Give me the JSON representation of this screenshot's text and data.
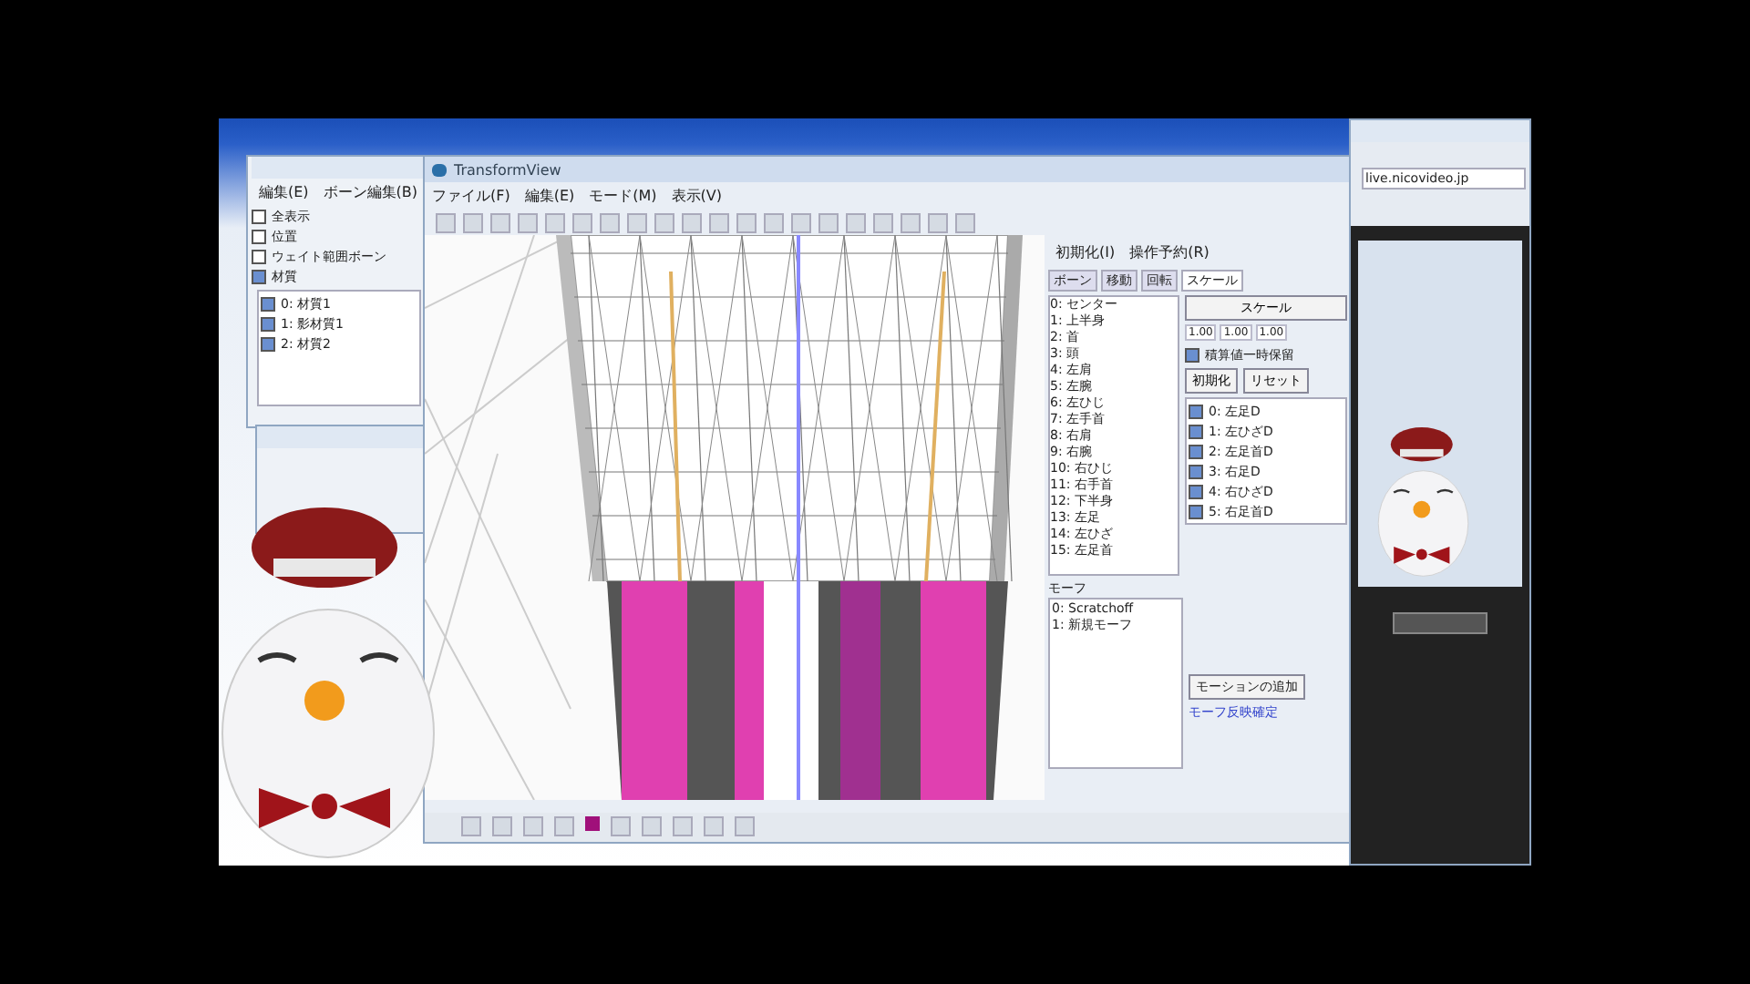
{
  "left_panel": {
    "menu": [
      "編集(E)",
      "ボーン編集(B)"
    ],
    "options": [
      {
        "label": "全表示",
        "checked": false
      },
      {
        "label": "位置",
        "checked": false
      },
      {
        "label": "ウェイト範囲ボーン",
        "checked": false
      },
      {
        "label": "材質",
        "checked": true
      }
    ],
    "items": [
      {
        "label": "0: 材質1",
        "checked": true
      },
      {
        "label": "1: 影材質1",
        "checked": true
      },
      {
        "label": "2: 材質2",
        "checked": true
      }
    ]
  },
  "main_window": {
    "title": "TransformView",
    "menu": [
      "ファイル(F)",
      "編集(E)",
      "モード(M)",
      "表示(V)"
    ]
  },
  "side_panel": {
    "menu": [
      "初期化(I)",
      "操作予約(R)"
    ],
    "tabs": [
      {
        "label": "ボーン",
        "selected": false
      },
      {
        "label": "移動",
        "selected": false
      },
      {
        "label": "回転",
        "selected": false
      },
      {
        "label": "スケール",
        "selected": true
      }
    ],
    "bones": [
      "0: センター",
      "1: 上半身",
      "2: 首",
      "3: 頭",
      "4: 左肩",
      "5: 左腕",
      "6: 左ひじ",
      "7: 左手首",
      "8: 右肩",
      "9: 右腕",
      "10: 右ひじ",
      "11: 右手首",
      "12: 下半身",
      "13: 左足",
      "14: 左ひざ",
      "15: 左足首"
    ],
    "scale_button": "スケール",
    "values": [
      "1.00",
      "1.00",
      "1.00"
    ],
    "hold": {
      "label": "積算値一時保留",
      "checked": true
    },
    "init_button": "初期化",
    "reset_button": "リセット",
    "targets": [
      {
        "label": "0: 左足D",
        "checked": true
      },
      {
        "label": "1: 左ひざD",
        "checked": true
      },
      {
        "label": "2: 左足首D",
        "checked": true
      },
      {
        "label": "3: 右足D",
        "checked": true
      },
      {
        "label": "4: 右ひざD",
        "checked": true
      },
      {
        "label": "5: 右足首D",
        "checked": true
      }
    ],
    "morph_label": "モーフ",
    "morphs": [
      "0: Scratchoff",
      "1: 新規モーフ"
    ],
    "links": [
      "モーションの追加",
      "モーフ反映確定"
    ]
  },
  "browser": {
    "address": "live.nicovideo.jp"
  }
}
